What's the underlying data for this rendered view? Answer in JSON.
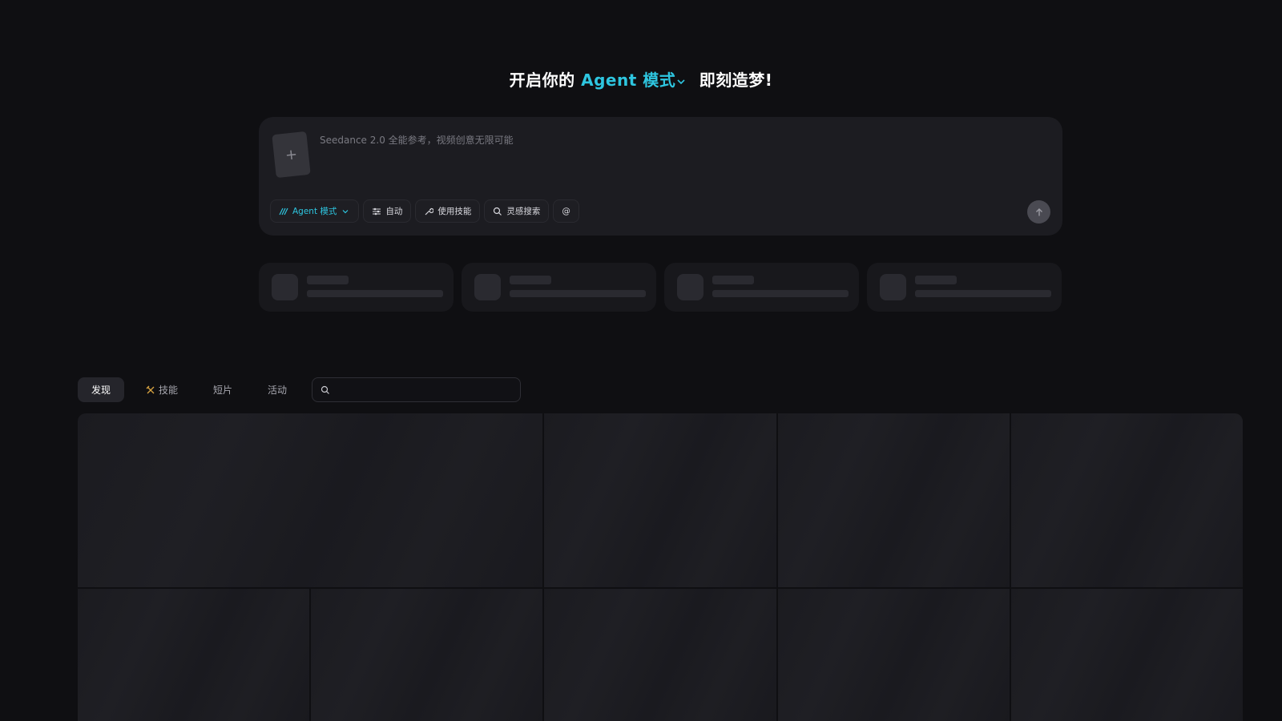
{
  "hero": {
    "prefix": "开启你的",
    "accent": "Agent 模式",
    "suffix": "即刻造梦!"
  },
  "composer": {
    "placeholder": "Seedance 2.0 全能参考，视频创意无限可能",
    "upload_icon": "plus-icon",
    "toolbar": [
      {
        "label": "Agent 模式",
        "icon": "agent-icon"
      },
      {
        "label": "自动",
        "icon": "sliders-icon"
      },
      {
        "label": "使用技能",
        "icon": "wrench-icon"
      },
      {
        "label": "灵感搜索",
        "icon": "search-spark-icon"
      },
      {
        "label": "@",
        "icon": "at-icon"
      }
    ],
    "send_icon": "arrow-up-icon"
  },
  "tabs": [
    {
      "label": "发现"
    },
    {
      "label": "技能",
      "icon": "tools-icon"
    },
    {
      "label": "短片"
    },
    {
      "label": "活动"
    }
  ],
  "search": {
    "placeholder": "",
    "icon": "search-icon"
  },
  "colors": {
    "accent": "#2ec6e0",
    "background": "#0f0f12",
    "panel": "#1c1c21"
  }
}
